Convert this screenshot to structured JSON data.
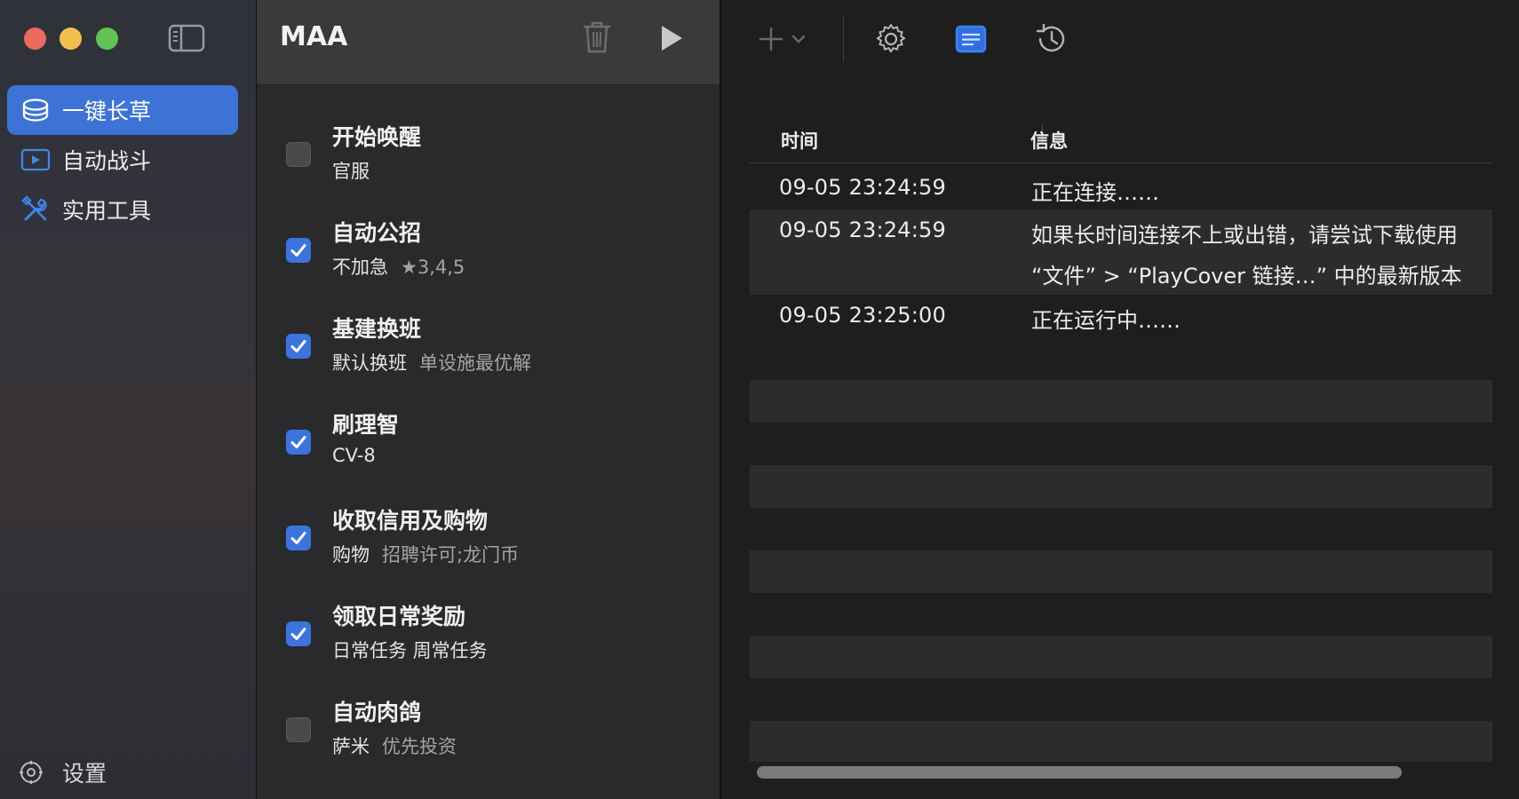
{
  "sidebar": {
    "items": [
      {
        "label": "一键长草",
        "icon": "server-stack-icon",
        "active": true
      },
      {
        "label": "自动战斗",
        "icon": "play-rectangle-icon",
        "active": false
      },
      {
        "label": "实用工具",
        "icon": "tools-icon",
        "active": false
      }
    ],
    "settings_label": "设置"
  },
  "tasks_panel": {
    "title": "MAA",
    "tasks": [
      {
        "title": "开始唤醒",
        "checked": false,
        "primary": "官服",
        "secondary": ""
      },
      {
        "title": "自动公招",
        "checked": true,
        "primary": "不加急",
        "secondary": "★3,4,5"
      },
      {
        "title": "基建换班",
        "checked": true,
        "primary": "默认换班",
        "secondary": "单设施最优解"
      },
      {
        "title": "刷理智",
        "checked": true,
        "primary": "CV-8",
        "secondary": ""
      },
      {
        "title": "收取信用及购物",
        "checked": true,
        "primary": "购物",
        "secondary": "招聘许可;龙门币"
      },
      {
        "title": "领取日常奖励",
        "checked": true,
        "primary": "日常任务 周常任务",
        "secondary": ""
      },
      {
        "title": "自动肉鸽",
        "checked": false,
        "primary": "萨米",
        "secondary": "优先投资"
      }
    ]
  },
  "log": {
    "columns": {
      "time": "时间",
      "message": "信息"
    },
    "rows": [
      {
        "time": "09-05 23:24:59",
        "message": "正在连接……",
        "message2": ""
      },
      {
        "time": "09-05 23:24:59",
        "message": "如果长时间连接不上或出错，请尝试下载使用",
        "message2": "“文件” > “PlayCover 链接…” 中的最新版本"
      },
      {
        "time": "09-05 23:25:00",
        "message": "正在运行中……",
        "message2": ""
      }
    ]
  },
  "colors": {
    "accent": "#3d73d6",
    "checkbox_on": "#3b74e0",
    "toolbar_active": "#3b82f6"
  }
}
